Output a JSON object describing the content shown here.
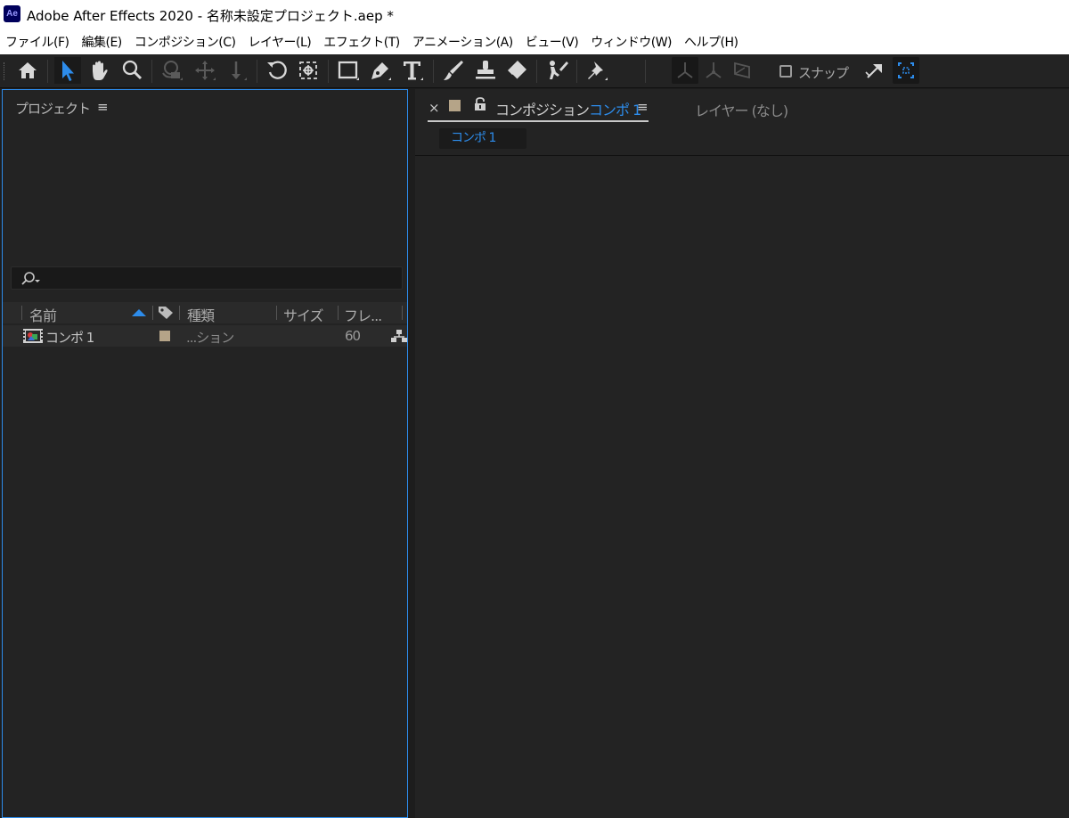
{
  "window": {
    "title": "Adobe After Effects 2020 - 名称未設定プロジェクト.aep *",
    "app_icon_text": "Ae"
  },
  "menu": {
    "items": [
      "ファイル(F)",
      "編集(E)",
      "コンポジション(C)",
      "レイヤー(L)",
      "エフェクト(T)",
      "アニメーション(A)",
      "ビュー(V)",
      "ウィンドウ(W)",
      "ヘルプ(H)"
    ]
  },
  "toolbar": {
    "tools": [
      "home",
      "selection",
      "hand",
      "zoom",
      "orbit",
      "pan",
      "dolly",
      "rotate",
      "anchor",
      "rectangle",
      "pen",
      "type",
      "brush",
      "clone-stamp",
      "eraser",
      "roto-brush",
      "puppet-pin"
    ],
    "active_tool": "selection",
    "snap_label": "スナップ",
    "snap_checked": false
  },
  "project_panel": {
    "title": "プロジェクト",
    "menu_glyph": "≡",
    "search": {
      "value": "",
      "placeholder": ""
    },
    "columns": {
      "name": "名前",
      "type": "種類",
      "size": "サイズ",
      "frame": "フレ..."
    },
    "items": [
      {
        "name": "コンポ 1",
        "type": "...ション",
        "frame": "60",
        "label_color": "#b5a488"
      }
    ]
  },
  "composition_panel": {
    "close_glyph": "×",
    "tab_prefix": "コンポジション",
    "tab_comp_name": "コンポ 1",
    "menu_glyph": "≡",
    "layer_tab": "レイヤー (なし)",
    "breadcrumb": "コンポ 1",
    "label_color": "#b5a488"
  },
  "colors": {
    "accent_blue": "#2d8ceb",
    "panel_bg": "#232323",
    "app_bg": "#1d1d1d"
  }
}
